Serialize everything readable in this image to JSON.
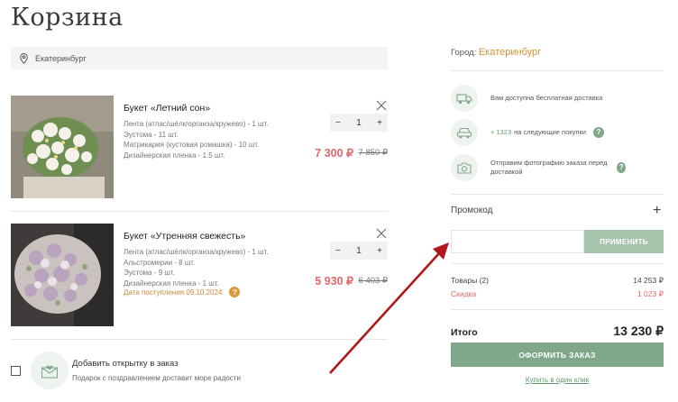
{
  "page": {
    "title": "Корзина"
  },
  "location": {
    "city_field": "Екатеринбург",
    "icon": "location-pin-icon"
  },
  "items": [
    {
      "name": "Букет «Летний сон»",
      "composition": [
        "Лента (атлас/шёлк/органза/кружево) - 1 шт.",
        "Эустома - 11 шт.",
        "Матрикария (кустовая ромашка) - 10 шт.",
        "Дизайнерская пленка - 1.5 шт."
      ],
      "qty": "1",
      "minus": "−",
      "plus": "+",
      "price": "7 300 ₽",
      "old_price": "7 850 ₽",
      "arrival": ""
    },
    {
      "name": "Букет «Утренняя свежесть»",
      "composition": [
        "Лента (атлас/шёлк/органза/кружево) - 1 шт.",
        "Альстромерии - 8 шт.",
        "Эустома - 9 шт.",
        "Дизайнерская пленка - 1 шт."
      ],
      "qty": "1",
      "minus": "−",
      "plus": "+",
      "price": "5 930 ₽",
      "old_price": "6 403 ₽",
      "arrival": "Дата поступления 09.10.2024"
    }
  ],
  "greeting_card": {
    "title": "Добавить открытку в заказ",
    "subtitle": "Подарок с поздравлением доставит море радости"
  },
  "sidebar": {
    "city_label": "Город:",
    "city_value": "Екатеринбург",
    "perks": [
      {
        "icon": "delivery-truck-icon",
        "highlight": "",
        "text": "Вам доступна бесплатная доставка"
      },
      {
        "icon": "car-icon",
        "highlight": "+ 1323",
        "text": "на следующие покупки"
      },
      {
        "icon": "camera-icon",
        "highlight": "",
        "text": "Отправим фотографию заказа перед доставкой"
      }
    ],
    "promo": {
      "label": "Промокод",
      "plus": "+",
      "input_value": "",
      "apply_button": "ПРИМЕНИТЬ"
    },
    "summary": {
      "goods_label": "Товары (2)",
      "goods_value": "14 253 ₽",
      "discount_label": "Скидка",
      "discount_value": "1 023 ₽",
      "total_label": "Итого",
      "total_value": "13 230 ₽"
    },
    "checkout_button": "ОФОРМИТЬ ЗАКАЗ",
    "one_click_link": "Купить в один клик"
  },
  "colors": {
    "accent_green": "#7fa88a",
    "price_red": "#e0676b",
    "city_orange": "#d49135",
    "annotation_arrow": "#b0181c"
  }
}
